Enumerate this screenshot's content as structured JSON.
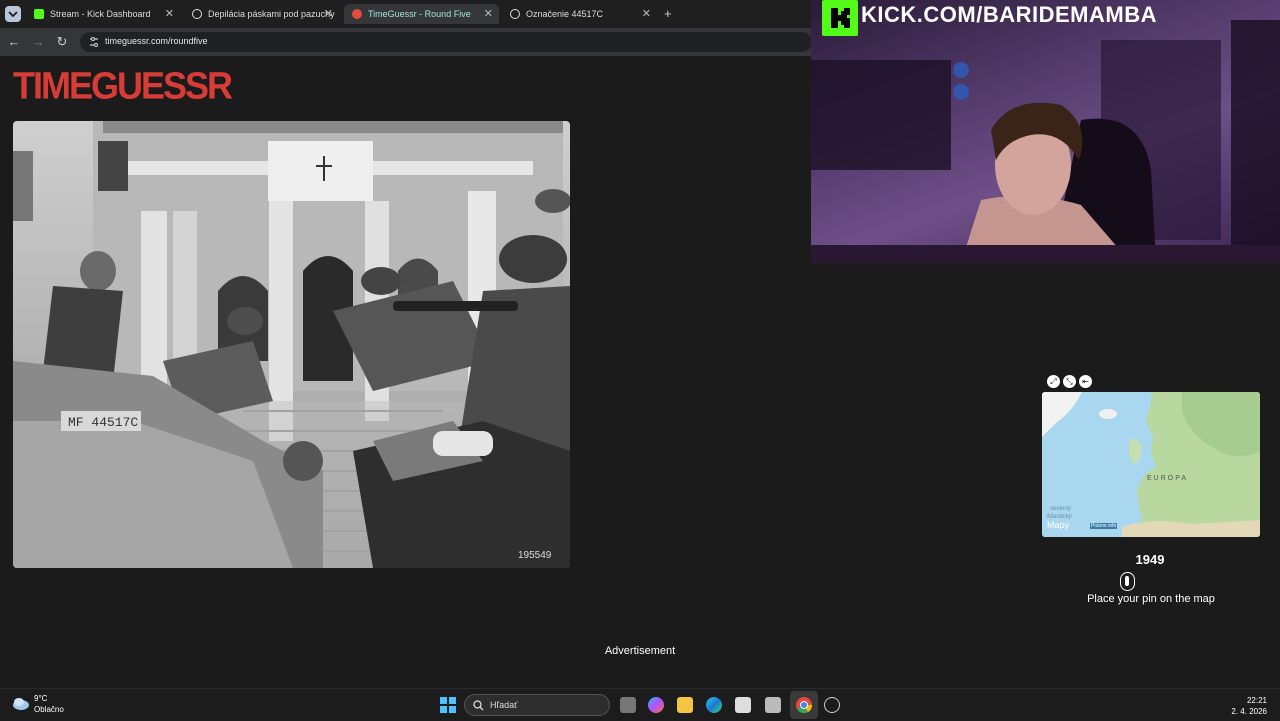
{
  "browser": {
    "tabs": [
      {
        "title": "Stream - Kick Dashboard",
        "favicon_color": "#53fc18"
      },
      {
        "title": "Depilácia páskami pod pazuchy",
        "favicon_color": "#ffffff"
      },
      {
        "title": "TimeGuessr - Round Five",
        "favicon_color": "#e34b3f"
      },
      {
        "title": "Označenie 44517C",
        "favicon_color": "#ffffff"
      }
    ],
    "new_tab_icon": "plus-icon",
    "url": "timeguessr.com/roundfive"
  },
  "page": {
    "logo_text": "TIMEGUESSR",
    "photo_text": {
      "vehicle_marking": "MF 44517C",
      "photo_number": "195549"
    },
    "advertisement": "Advertisement"
  },
  "stream": {
    "kick_url": "KICK.COM/BARIDEMAMBA",
    "brand_color": "#53fc18"
  },
  "map": {
    "region_label": "EURÓPA",
    "ocean_label_1": "severný",
    "ocean_label_2": "Atlantický",
    "attribution": "Mapy",
    "legal": "Právne info",
    "controls": [
      "expand-icon",
      "collapse-icon",
      "arrow-icon"
    ]
  },
  "game": {
    "year": "1949",
    "instruction": "Place your pin on the map"
  },
  "taskbar": {
    "weather_temp": "9°C",
    "weather_desc": "Oblačno",
    "search_placeholder": "Hľadať",
    "time": "22:21",
    "date": "2. 4. 2026"
  }
}
